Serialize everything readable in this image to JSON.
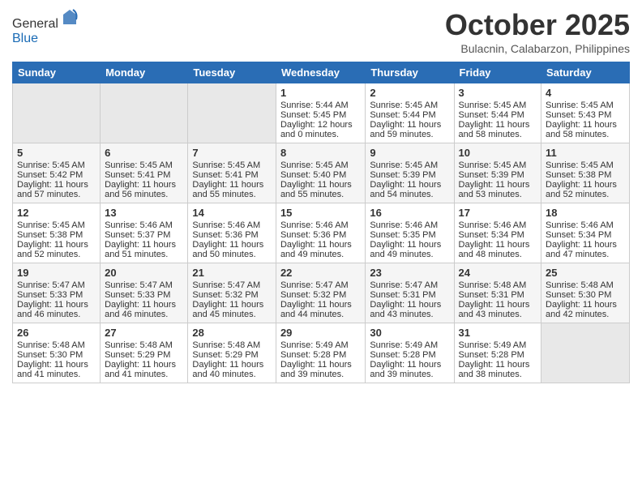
{
  "header": {
    "logo_general": "General",
    "logo_blue": "Blue",
    "month_title": "October 2025",
    "location": "Bulacnin, Calabarzon, Philippines"
  },
  "days_of_week": [
    "Sunday",
    "Monday",
    "Tuesday",
    "Wednesday",
    "Thursday",
    "Friday",
    "Saturday"
  ],
  "weeks": [
    [
      {
        "day": "",
        "sunrise": "",
        "sunset": "",
        "daylight": ""
      },
      {
        "day": "",
        "sunrise": "",
        "sunset": "",
        "daylight": ""
      },
      {
        "day": "",
        "sunrise": "",
        "sunset": "",
        "daylight": ""
      },
      {
        "day": "1",
        "sunrise": "Sunrise: 5:44 AM",
        "sunset": "Sunset: 5:45 PM",
        "daylight": "Daylight: 12 hours and 0 minutes."
      },
      {
        "day": "2",
        "sunrise": "Sunrise: 5:45 AM",
        "sunset": "Sunset: 5:44 PM",
        "daylight": "Daylight: 11 hours and 59 minutes."
      },
      {
        "day": "3",
        "sunrise": "Sunrise: 5:45 AM",
        "sunset": "Sunset: 5:44 PM",
        "daylight": "Daylight: 11 hours and 58 minutes."
      },
      {
        "day": "4",
        "sunrise": "Sunrise: 5:45 AM",
        "sunset": "Sunset: 5:43 PM",
        "daylight": "Daylight: 11 hours and 58 minutes."
      }
    ],
    [
      {
        "day": "5",
        "sunrise": "Sunrise: 5:45 AM",
        "sunset": "Sunset: 5:42 PM",
        "daylight": "Daylight: 11 hours and 57 minutes."
      },
      {
        "day": "6",
        "sunrise": "Sunrise: 5:45 AM",
        "sunset": "Sunset: 5:41 PM",
        "daylight": "Daylight: 11 hours and 56 minutes."
      },
      {
        "day": "7",
        "sunrise": "Sunrise: 5:45 AM",
        "sunset": "Sunset: 5:41 PM",
        "daylight": "Daylight: 11 hours and 55 minutes."
      },
      {
        "day": "8",
        "sunrise": "Sunrise: 5:45 AM",
        "sunset": "Sunset: 5:40 PM",
        "daylight": "Daylight: 11 hours and 55 minutes."
      },
      {
        "day": "9",
        "sunrise": "Sunrise: 5:45 AM",
        "sunset": "Sunset: 5:39 PM",
        "daylight": "Daylight: 11 hours and 54 minutes."
      },
      {
        "day": "10",
        "sunrise": "Sunrise: 5:45 AM",
        "sunset": "Sunset: 5:39 PM",
        "daylight": "Daylight: 11 hours and 53 minutes."
      },
      {
        "day": "11",
        "sunrise": "Sunrise: 5:45 AM",
        "sunset": "Sunset: 5:38 PM",
        "daylight": "Daylight: 11 hours and 52 minutes."
      }
    ],
    [
      {
        "day": "12",
        "sunrise": "Sunrise: 5:45 AM",
        "sunset": "Sunset: 5:38 PM",
        "daylight": "Daylight: 11 hours and 52 minutes."
      },
      {
        "day": "13",
        "sunrise": "Sunrise: 5:46 AM",
        "sunset": "Sunset: 5:37 PM",
        "daylight": "Daylight: 11 hours and 51 minutes."
      },
      {
        "day": "14",
        "sunrise": "Sunrise: 5:46 AM",
        "sunset": "Sunset: 5:36 PM",
        "daylight": "Daylight: 11 hours and 50 minutes."
      },
      {
        "day": "15",
        "sunrise": "Sunrise: 5:46 AM",
        "sunset": "Sunset: 5:36 PM",
        "daylight": "Daylight: 11 hours and 49 minutes."
      },
      {
        "day": "16",
        "sunrise": "Sunrise: 5:46 AM",
        "sunset": "Sunset: 5:35 PM",
        "daylight": "Daylight: 11 hours and 49 minutes."
      },
      {
        "day": "17",
        "sunrise": "Sunrise: 5:46 AM",
        "sunset": "Sunset: 5:34 PM",
        "daylight": "Daylight: 11 hours and 48 minutes."
      },
      {
        "day": "18",
        "sunrise": "Sunrise: 5:46 AM",
        "sunset": "Sunset: 5:34 PM",
        "daylight": "Daylight: 11 hours and 47 minutes."
      }
    ],
    [
      {
        "day": "19",
        "sunrise": "Sunrise: 5:47 AM",
        "sunset": "Sunset: 5:33 PM",
        "daylight": "Daylight: 11 hours and 46 minutes."
      },
      {
        "day": "20",
        "sunrise": "Sunrise: 5:47 AM",
        "sunset": "Sunset: 5:33 PM",
        "daylight": "Daylight: 11 hours and 46 minutes."
      },
      {
        "day": "21",
        "sunrise": "Sunrise: 5:47 AM",
        "sunset": "Sunset: 5:32 PM",
        "daylight": "Daylight: 11 hours and 45 minutes."
      },
      {
        "day": "22",
        "sunrise": "Sunrise: 5:47 AM",
        "sunset": "Sunset: 5:32 PM",
        "daylight": "Daylight: 11 hours and 44 minutes."
      },
      {
        "day": "23",
        "sunrise": "Sunrise: 5:47 AM",
        "sunset": "Sunset: 5:31 PM",
        "daylight": "Daylight: 11 hours and 43 minutes."
      },
      {
        "day": "24",
        "sunrise": "Sunrise: 5:48 AM",
        "sunset": "Sunset: 5:31 PM",
        "daylight": "Daylight: 11 hours and 43 minutes."
      },
      {
        "day": "25",
        "sunrise": "Sunrise: 5:48 AM",
        "sunset": "Sunset: 5:30 PM",
        "daylight": "Daylight: 11 hours and 42 minutes."
      }
    ],
    [
      {
        "day": "26",
        "sunrise": "Sunrise: 5:48 AM",
        "sunset": "Sunset: 5:30 PM",
        "daylight": "Daylight: 11 hours and 41 minutes."
      },
      {
        "day": "27",
        "sunrise": "Sunrise: 5:48 AM",
        "sunset": "Sunset: 5:29 PM",
        "daylight": "Daylight: 11 hours and 41 minutes."
      },
      {
        "day": "28",
        "sunrise": "Sunrise: 5:48 AM",
        "sunset": "Sunset: 5:29 PM",
        "daylight": "Daylight: 11 hours and 40 minutes."
      },
      {
        "day": "29",
        "sunrise": "Sunrise: 5:49 AM",
        "sunset": "Sunset: 5:28 PM",
        "daylight": "Daylight: 11 hours and 39 minutes."
      },
      {
        "day": "30",
        "sunrise": "Sunrise: 5:49 AM",
        "sunset": "Sunset: 5:28 PM",
        "daylight": "Daylight: 11 hours and 39 minutes."
      },
      {
        "day": "31",
        "sunrise": "Sunrise: 5:49 AM",
        "sunset": "Sunset: 5:28 PM",
        "daylight": "Daylight: 11 hours and 38 minutes."
      },
      {
        "day": "",
        "sunrise": "",
        "sunset": "",
        "daylight": ""
      }
    ]
  ]
}
